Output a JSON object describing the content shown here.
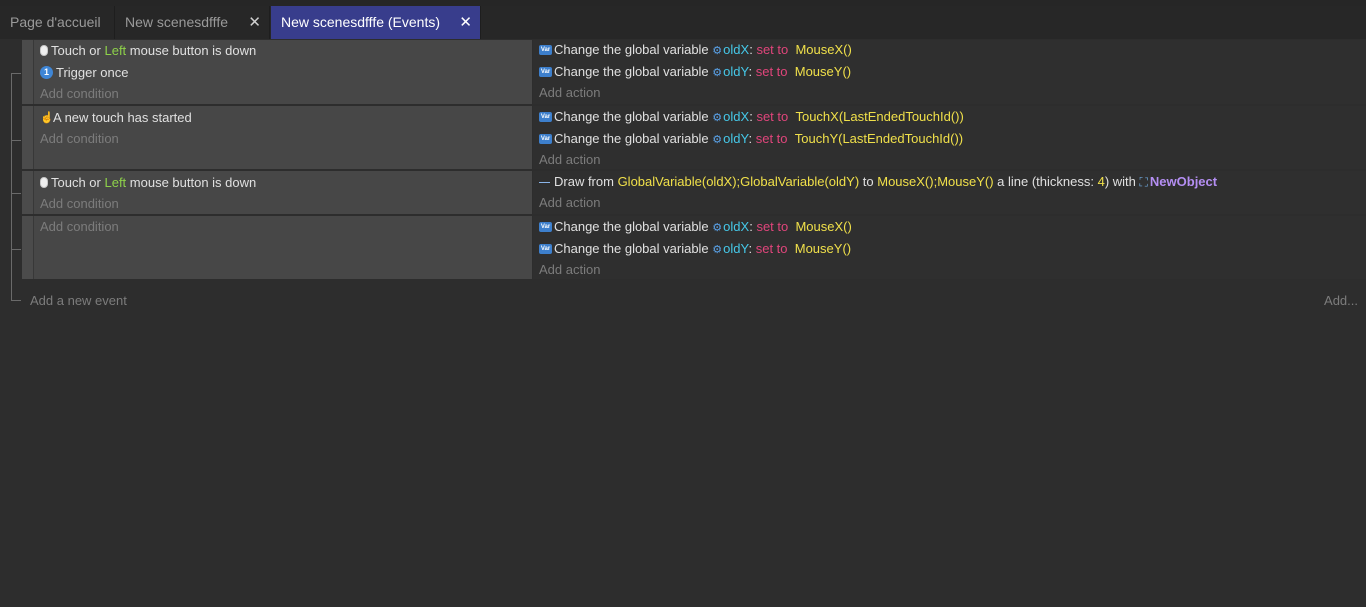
{
  "tabs": [
    {
      "label": "Page d'accueil",
      "closable": false,
      "active": false
    },
    {
      "label": "New scenesdfffe",
      "closable": true,
      "active": false
    },
    {
      "label": "New scenesdfffe (Events)",
      "closable": true,
      "active": true
    }
  ],
  "close_glyph": "✕",
  "events": [
    {
      "conditions": [
        {
          "icon": "mouse-icon",
          "parts": {
            "a": "Touch or ",
            "b": "Left",
            "c": " mouse button is down"
          }
        },
        {
          "icon": "trigger-once-icon",
          "icon_text": "1",
          "parts": {
            "a": "Trigger once"
          }
        }
      ],
      "add_condition": "Add condition",
      "actions": [
        {
          "text": "Change the global variable ",
          "var": "oldX",
          "colon": ":",
          "op": "set to",
          "expr": "MouseX()"
        },
        {
          "text": "Change the global variable ",
          "var": "oldY",
          "colon": ":",
          "op": "set to",
          "expr": "MouseY()"
        }
      ],
      "add_action": "Add action"
    },
    {
      "conditions": [
        {
          "icon": "touch-icon",
          "parts": {
            "a": "A new touch has started"
          }
        }
      ],
      "add_condition": "Add condition",
      "actions": [
        {
          "text": "Change the global variable ",
          "var": "oldX",
          "colon": ":",
          "op": "set to",
          "expr": "TouchX(LastEndedTouchId())"
        },
        {
          "text": "Change the global variable ",
          "var": "oldY",
          "colon": ":",
          "op": "set to",
          "expr": "TouchY(LastEndedTouchId())"
        }
      ],
      "add_action": "Add action"
    },
    {
      "conditions": [
        {
          "icon": "mouse-icon",
          "parts": {
            "a": "Touch or ",
            "b": "Left",
            "c": " mouse button is down"
          }
        }
      ],
      "add_condition": "Add condition",
      "draw_action": {
        "t1": "Draw from ",
        "e1": "GlobalVariable(oldX);GlobalVariable(oldY)",
        "t2": " to ",
        "e2": "MouseX();MouseY()",
        "t3": " a line (thickness: ",
        "e3": "4",
        "t4": ") with ",
        "obj": "NewObject"
      },
      "add_action": "Add action"
    },
    {
      "conditions": [],
      "add_condition": "Add condition",
      "actions": [
        {
          "text": "Change the global variable ",
          "var": "oldX",
          "colon": ":",
          "op": "set to",
          "expr": "MouseX()"
        },
        {
          "text": "Change the global variable ",
          "var": "oldY",
          "colon": ":",
          "op": "set to",
          "expr": "MouseY()"
        }
      ],
      "add_action": "Add action"
    }
  ],
  "add_event": "Add a new event",
  "add_more": "Add...",
  "icons": {
    "var_badge": "Var",
    "gear": "⚙",
    "touch": "☝",
    "object": "⛶"
  },
  "colors": {
    "accent_tab": "#383d8c",
    "keyword_green": "#8ed14a",
    "variable": "#45c8e8",
    "operator": "#e0457b",
    "expression": "#f0e04a",
    "object": "#b48ef2"
  }
}
